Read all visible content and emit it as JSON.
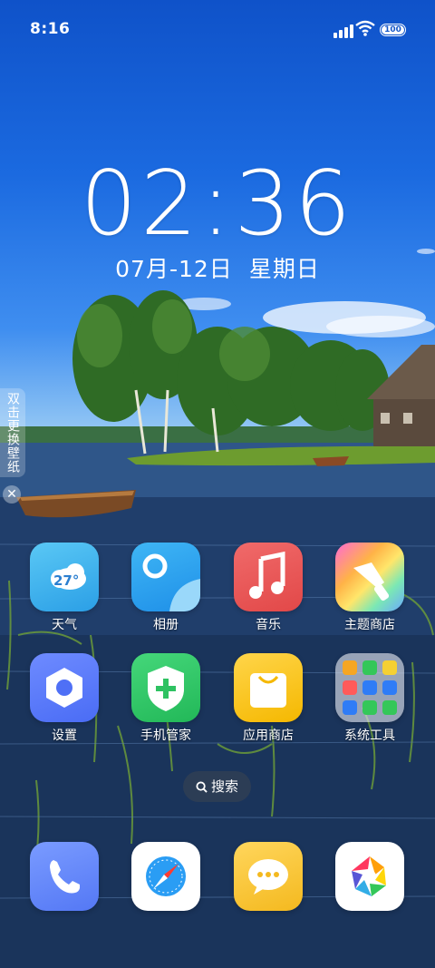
{
  "status_bar": {
    "time": "8:16",
    "battery": "100"
  },
  "lockscreen": {
    "clock": "02:36",
    "date": "07月-12日",
    "weekday": "星期日"
  },
  "wallpaper_tab": {
    "label": "双击更换壁纸",
    "close": "✕"
  },
  "apps": [
    {
      "label": "天气",
      "temp": "27°"
    },
    {
      "label": "相册"
    },
    {
      "label": "音乐"
    },
    {
      "label": "主题商店"
    },
    {
      "label": "设置"
    },
    {
      "label": "手机管家"
    },
    {
      "label": "应用商店"
    },
    {
      "label": "系统工具"
    }
  ],
  "search": {
    "label": "搜索"
  },
  "dock": [
    {
      "name": "phone"
    },
    {
      "name": "browser"
    },
    {
      "name": "messages"
    },
    {
      "name": "camera"
    }
  ],
  "colors": {
    "sky": "#1b6ae0",
    "water": "#1d3b66"
  }
}
